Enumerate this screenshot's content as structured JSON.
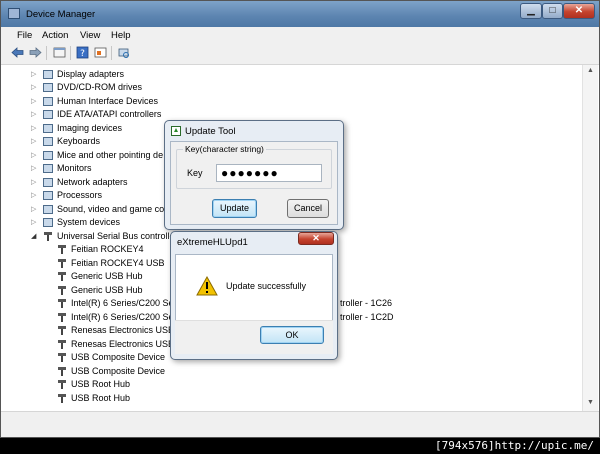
{
  "window": {
    "title": "Device Manager",
    "minimize_glyph": "▁",
    "maximize_glyph": "□",
    "close_glyph": "✕"
  },
  "menu": [
    "File",
    "Action",
    "View",
    "Help"
  ],
  "toolbar": {
    "icons": [
      "back-arrow-icon",
      "forward-arrow-icon",
      "properties-icon",
      "help-icon",
      "show-hidden-icon",
      "scan-hardware-icon"
    ]
  },
  "tree": {
    "categories": [
      {
        "label": "Display adapters",
        "expander": "▷"
      },
      {
        "label": "DVD/CD-ROM drives",
        "expander": "▷"
      },
      {
        "label": "Human Interface Devices",
        "expander": "▷"
      },
      {
        "label": "IDE ATA/ATAPI controllers",
        "expander": "▷"
      },
      {
        "label": "Imaging devices",
        "expander": "▷"
      },
      {
        "label": "Keyboards",
        "expander": "▷"
      },
      {
        "label": "Mice and other pointing de",
        "expander": "▷"
      },
      {
        "label": "Monitors",
        "expander": "▷"
      },
      {
        "label": "Network adapters",
        "expander": "▷"
      },
      {
        "label": "Processors",
        "expander": "▷"
      },
      {
        "label": "Sound, video and game co",
        "expander": "▷"
      },
      {
        "label": "System devices",
        "expander": "▷"
      },
      {
        "label": "Universal Serial Bus controlle",
        "expander": "◢"
      }
    ],
    "usb_children": [
      "Feitian ROCKEY4",
      "Feitian ROCKEY4 USB",
      "Generic USB Hub",
      "Generic USB Hub",
      "Intel(R) 6 Series/C200 Seri",
      "Intel(R) 6 Series/C200 Seri",
      "Renesas Electronics USB 3",
      "Renesas Electronics USB 3",
      "USB Composite Device",
      "USB Composite Device",
      "USB Root Hub",
      "USB Root Hub"
    ],
    "truncated_suffixes": [
      "troller - 1C26",
      "troller - 1C2D"
    ]
  },
  "scrollbar": {
    "up": "▲",
    "down": "▼"
  },
  "update_dialog": {
    "title": "Update Tool",
    "group_label": "Key(character string)",
    "key_label": "Key",
    "key_value": "●●●●●●●",
    "update_button": "Update",
    "cancel_button": "Cancel"
  },
  "message_dialog": {
    "title": "eXtremeHLUpd1",
    "message": "Update successfully",
    "ok_button": "OK",
    "close_glyph": "✕"
  },
  "caption": "[794x576]http://upic.me/",
  "colors": {
    "titlebar": "#5c84b0",
    "close_red": "#c5432e",
    "focus_blue": "#3c7fb1",
    "warning_yellow": "#f2c200"
  }
}
